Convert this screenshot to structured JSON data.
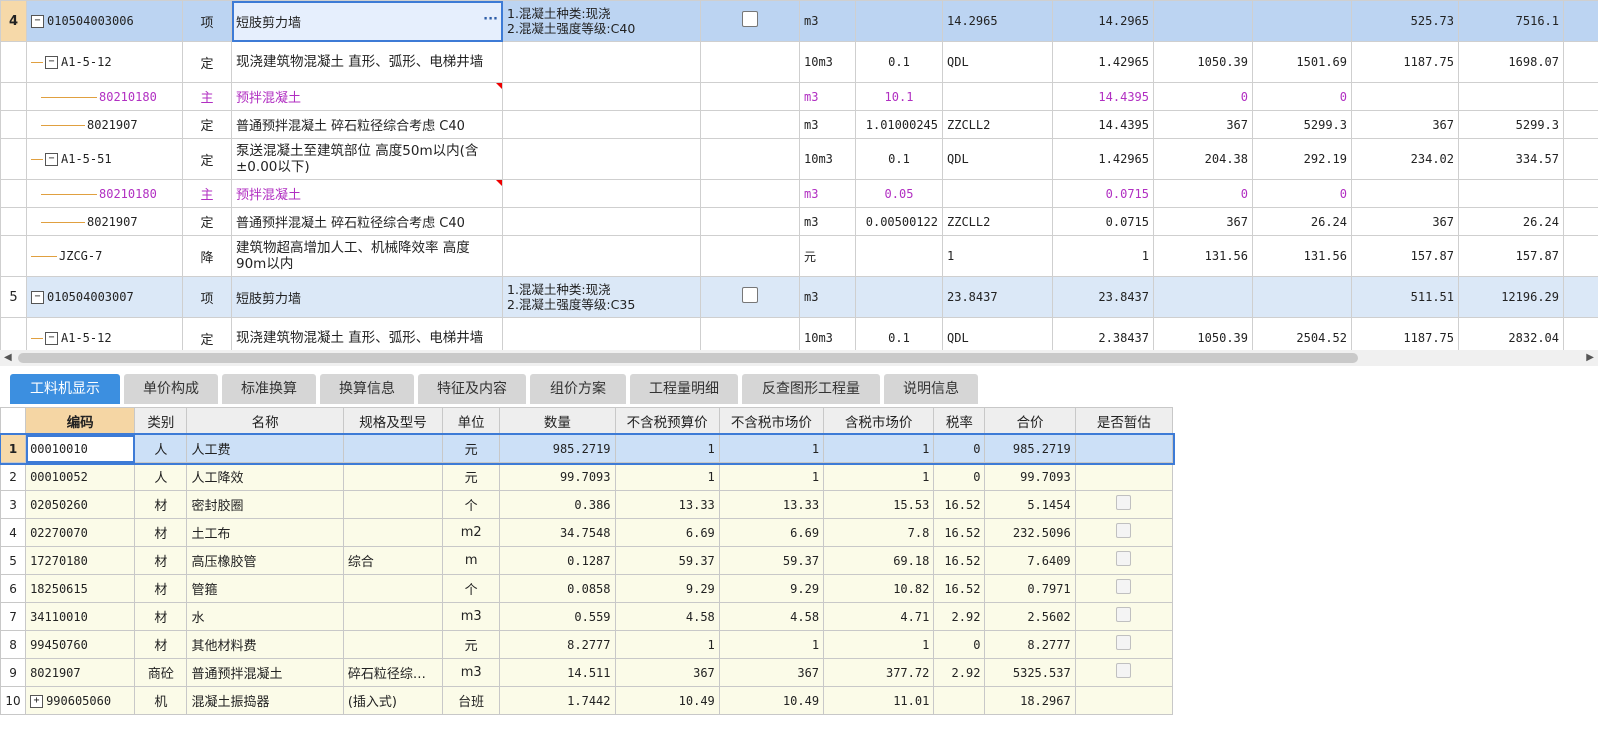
{
  "upper": {
    "rows": [
      {
        "rn": "4",
        "code": "010504003006",
        "type": "项",
        "name": "短肢剪力墙",
        "spec": "1.混凝土种类:现浇\n2.混凝土强度等级:C40",
        "unit": "m3",
        "qty_expr": "",
        "rate_code": "14.2965",
        "qty": "14.2965",
        "p1": "",
        "p2": "",
        "p3": "525.73",
        "p4": "7516.1"
      },
      {
        "rn": "",
        "code": "A1-5-12",
        "type": "定",
        "name": "现浇建筑物混凝土 直形、弧形、电梯井墙",
        "spec": "",
        "unit": "10m3",
        "qty_expr": "0.1",
        "rate_code": "QDL",
        "qty": "1.42965",
        "p1": "1050.39",
        "p2": "1501.69",
        "p3": "1187.75",
        "p4": "1698.07"
      },
      {
        "rn": "",
        "code": "80210180",
        "type": "主",
        "name": "预拌混凝土",
        "spec": "",
        "unit": "m3",
        "qty_expr": "10.1",
        "rate_code": "",
        "qty": "14.4395",
        "p1": "0",
        "p2": "0",
        "p3": "",
        "p4": ""
      },
      {
        "rn": "",
        "code": "8021907",
        "type": "定",
        "name": "普通预拌混凝土 碎石粒径综合考虑 C40",
        "spec": "",
        "unit": "m3",
        "qty_expr": "1.01000245",
        "rate_code": "ZZCLL2",
        "qty": "14.4395",
        "p1": "367",
        "p2": "5299.3",
        "p3": "367",
        "p4": "5299.3"
      },
      {
        "rn": "",
        "code": "A1-5-51",
        "type": "定",
        "name": "泵送混凝土至建筑部位 高度50m以内(含±0.00以下)",
        "spec": "",
        "unit": "10m3",
        "qty_expr": "0.1",
        "rate_code": "QDL",
        "qty": "1.42965",
        "p1": "204.38",
        "p2": "292.19",
        "p3": "234.02",
        "p4": "334.57"
      },
      {
        "rn": "",
        "code": "80210180",
        "type": "主",
        "name": "预拌混凝土",
        "spec": "",
        "unit": "m3",
        "qty_expr": "0.05",
        "rate_code": "",
        "qty": "0.0715",
        "p1": "0",
        "p2": "0",
        "p3": "",
        "p4": ""
      },
      {
        "rn": "",
        "code": "8021907",
        "type": "定",
        "name": "普通预拌混凝土 碎石粒径综合考虑 C40",
        "spec": "",
        "unit": "m3",
        "qty_expr": "0.00500122",
        "rate_code": "ZZCLL2",
        "qty": "0.0715",
        "p1": "367",
        "p2": "26.24",
        "p3": "367",
        "p4": "26.24"
      },
      {
        "rn": "",
        "code": "JZCG-7",
        "type": "降",
        "name": "建筑物超高增加人工、机械降效率 高度90m以内",
        "spec": "",
        "unit": "元",
        "qty_expr": "",
        "rate_code": "1",
        "qty": "1",
        "p1": "131.56",
        "p2": "131.56",
        "p3": "157.87",
        "p4": "157.87"
      },
      {
        "rn": "5",
        "code": "010504003007",
        "type": "项",
        "name": "短肢剪力墙",
        "spec": "1.混凝土种类:现浇\n2.混凝土强度等级:C35",
        "unit": "m3",
        "qty_expr": "",
        "rate_code": "23.8437",
        "qty": "23.8437",
        "p1": "",
        "p2": "",
        "p3": "511.51",
        "p4": "12196.29"
      },
      {
        "rn": "",
        "code": "A1-5-12",
        "type": "定",
        "name": "现浇建筑物混凝土 直形、弧形、电梯井墙",
        "spec": "",
        "unit": "10m3",
        "qty_expr": "0.1",
        "rate_code": "QDL",
        "qty": "2.38437",
        "p1": "1050.39",
        "p2": "2504.52",
        "p3": "1187.75",
        "p4": "2832.04"
      }
    ]
  },
  "tabs": [
    "工料机显示",
    "单价构成",
    "标准换算",
    "换算信息",
    "特征及内容",
    "组价方案",
    "工程量明细",
    "反查图形工程量",
    "说明信息"
  ],
  "lower": {
    "headers": [
      "编码",
      "类别",
      "名称",
      "规格及型号",
      "单位",
      "数量",
      "不含税预算价",
      "不含税市场价",
      "含税市场价",
      "税率",
      "合价",
      "是否暂估"
    ],
    "rows": [
      {
        "rn": "1",
        "code": "00010010",
        "cat": "人",
        "name": "人工费",
        "spec": "",
        "unit": "元",
        "qty": "985.2719",
        "p1": "1",
        "p2": "1",
        "p3": "1",
        "tax": "0",
        "total": "985.2719",
        "est": false
      },
      {
        "rn": "2",
        "code": "00010052",
        "cat": "人",
        "name": "人工降效",
        "spec": "",
        "unit": "元",
        "qty": "99.7093",
        "p1": "1",
        "p2": "1",
        "p3": "1",
        "tax": "0",
        "total": "99.7093",
        "est": false
      },
      {
        "rn": "3",
        "code": "02050260",
        "cat": "材",
        "name": "密封胶圈",
        "spec": "",
        "unit": "个",
        "qty": "0.386",
        "p1": "13.33",
        "p2": "13.33",
        "p3": "15.53",
        "tax": "16.52",
        "total": "5.1454",
        "est": true
      },
      {
        "rn": "4",
        "code": "02270070",
        "cat": "材",
        "name": "土工布",
        "spec": "",
        "unit": "m2",
        "qty": "34.7548",
        "p1": "6.69",
        "p2": "6.69",
        "p3": "7.8",
        "tax": "16.52",
        "total": "232.5096",
        "est": true
      },
      {
        "rn": "5",
        "code": "17270180",
        "cat": "材",
        "name": "高压橡胶管",
        "spec": "综合",
        "unit": "m",
        "qty": "0.1287",
        "p1": "59.37",
        "p2": "59.37",
        "p3": "69.18",
        "tax": "16.52",
        "total": "7.6409",
        "est": true
      },
      {
        "rn": "6",
        "code": "18250615",
        "cat": "材",
        "name": "管箍",
        "spec": "",
        "unit": "个",
        "qty": "0.0858",
        "p1": "9.29",
        "p2": "9.29",
        "p3": "10.82",
        "tax": "16.52",
        "total": "0.7971",
        "est": true
      },
      {
        "rn": "7",
        "code": "34110010",
        "cat": "材",
        "name": "水",
        "spec": "",
        "unit": "m3",
        "qty": "0.559",
        "p1": "4.58",
        "p2": "4.58",
        "p3": "4.71",
        "tax": "2.92",
        "total": "2.5602",
        "est": true
      },
      {
        "rn": "8",
        "code": "99450760",
        "cat": "材",
        "name": "其他材料费",
        "spec": "",
        "unit": "元",
        "qty": "8.2777",
        "p1": "1",
        "p2": "1",
        "p3": "1",
        "tax": "0",
        "total": "8.2777",
        "est": true
      },
      {
        "rn": "9",
        "code": "8021907",
        "cat": "商砼",
        "name": "普通预拌混凝土",
        "spec": "碎石粒径综…",
        "unit": "m3",
        "qty": "14.511",
        "p1": "367",
        "p2": "367",
        "p3": "377.72",
        "tax": "2.92",
        "total": "5325.537",
        "est": true
      },
      {
        "rn": "10",
        "code": "990605060",
        "cat": "机",
        "name": "混凝土振捣器",
        "spec": "(插入式)",
        "unit": "台班",
        "qty": "1.7442",
        "p1": "10.49",
        "p2": "10.49",
        "p3": "11.01",
        "tax": "",
        "total": "18.2967",
        "est": false
      }
    ]
  },
  "icons": {
    "collapse": "−",
    "expand": "+",
    "more": "···"
  }
}
